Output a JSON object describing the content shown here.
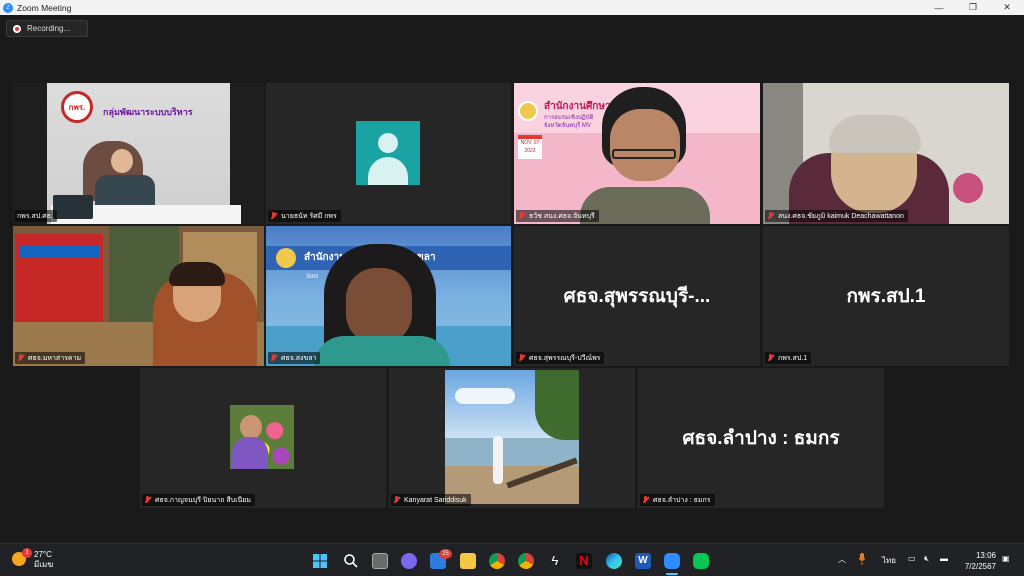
{
  "window": {
    "title": "Zoom Meeting",
    "minimize": "—",
    "maximize": "❐",
    "close": "✕"
  },
  "recording": {
    "label": "Recording..."
  },
  "participants": [
    {
      "name": "กพร.สป.ศธ.",
      "muted": false,
      "display": "video"
    },
    {
      "name": "นายธนัท รัศมี กพร",
      "muted": true,
      "display": "avatar"
    },
    {
      "name": "ธวัช สนง.ศธจ.จันทบุรี",
      "muted": true,
      "display": "video"
    },
    {
      "name": "สนง.ศธจ.ชัยภูมิ  kaimuk Deachawattanon",
      "muted": true,
      "display": "video"
    },
    {
      "name": "ศธจ.มหาสารคาม",
      "muted": true,
      "display": "video"
    },
    {
      "name": "ศธจ.สงขลา",
      "muted": true,
      "display": "video"
    },
    {
      "name": "ศธจ.สุพรรณบุรี-ปวีณ์พร",
      "muted": true,
      "display": "name",
      "big_label": "ศธจ.สุพรรณบุรี-..."
    },
    {
      "name": "กพร.สป.1",
      "muted": true,
      "display": "name",
      "big_label": "กพร.สป.1"
    },
    {
      "name": "ศธจ.กาญจนบุรี ปิยนาถ สืบเนียม",
      "muted": true,
      "display": "photo"
    },
    {
      "name": "Kanyarat Sariddisuk",
      "muted": true,
      "display": "photo"
    },
    {
      "name": "ศธจ.ลำปาง : ธมกร",
      "muted": true,
      "display": "name",
      "big_label": "ศธจ.ลำปาง : ธมกร"
    }
  ],
  "video_text": {
    "t1_logo": "กพร.",
    "t1_sign": "กลุ่มพัฒนาระบบบริหาร",
    "t3_banner": "สำนักงานศึกษา",
    "t3_sub": "การอบรมเชิงปฏิบัติ",
    "t3_sub2": "จังหวัดจันทบุรี MV",
    "t3_date": "NOV. 07",
    "t3_year": "2023",
    "t6_banner": "สำนักงาน           จังหวัดสงขลา",
    "t6_sub": "Som                          ation Office"
  },
  "taskbar": {
    "temperature": "27°C",
    "weather_desc": "มีเมฆ",
    "weather_badge": "1",
    "mail_badge": "25",
    "language": "ไทย",
    "time": "13:06",
    "date": "7/2/2567"
  },
  "colors": {
    "active_speaker": "#c8e36a",
    "muted_mic": "#e53935",
    "tile_bg": "#262626",
    "taskbar_bg": "#202225"
  }
}
